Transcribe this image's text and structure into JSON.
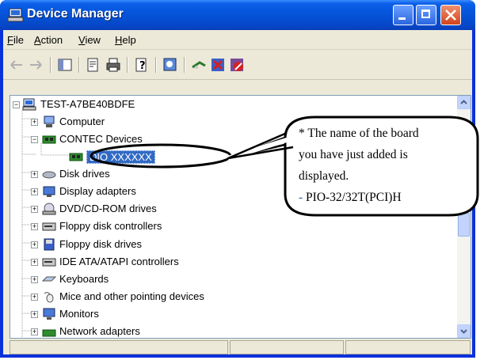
{
  "window": {
    "title": "Device Manager"
  },
  "menu": {
    "items": [
      {
        "label": "File",
        "accel": "F"
      },
      {
        "label": "Action",
        "accel": "A"
      },
      {
        "label": "View",
        "accel": "V"
      },
      {
        "label": "Help",
        "accel": "H"
      }
    ]
  },
  "toolbar": {
    "icons": [
      "back-arrow-icon",
      "forward-arrow-icon",
      "show-hide-tree-icon",
      "properties-icon",
      "print-icon",
      "help-icon",
      "scan-hardware-icon",
      "update-driver-icon",
      "uninstall-icon",
      "disable-icon"
    ]
  },
  "tree": {
    "root": "TEST-A7BE40BDFE",
    "nodes": [
      {
        "label": "Computer",
        "expander": "+"
      },
      {
        "label": "CONTEC Devices",
        "expander": "−"
      },
      {
        "label": "DIO  XXXXXX",
        "selected": true
      },
      {
        "label": "Disk drives",
        "expander": "+"
      },
      {
        "label": "Display adapters",
        "expander": "+"
      },
      {
        "label": "DVD/CD-ROM drives",
        "expander": "+"
      },
      {
        "label": "Floppy disk controllers",
        "expander": "+"
      },
      {
        "label": "Floppy disk drives",
        "expander": "+"
      },
      {
        "label": "IDE ATA/ATAPI controllers",
        "expander": "+"
      },
      {
        "label": "Keyboards",
        "expander": "+"
      },
      {
        "label": "Mice and other pointing devices",
        "expander": "+"
      },
      {
        "label": "Monitors",
        "expander": "+"
      },
      {
        "label": "Network adapters",
        "expander": "+"
      }
    ]
  },
  "callout": {
    "line1": "* The name of the board",
    "line2": "you have just added is",
    "line3": "displayed.",
    "line4_prefix": "- ",
    "line4_value": "PIO-32/32T(PCI)H"
  },
  "colors": {
    "title_bar": "#0551d6",
    "selection": "#316ac5",
    "frame": "#ece9d8"
  }
}
